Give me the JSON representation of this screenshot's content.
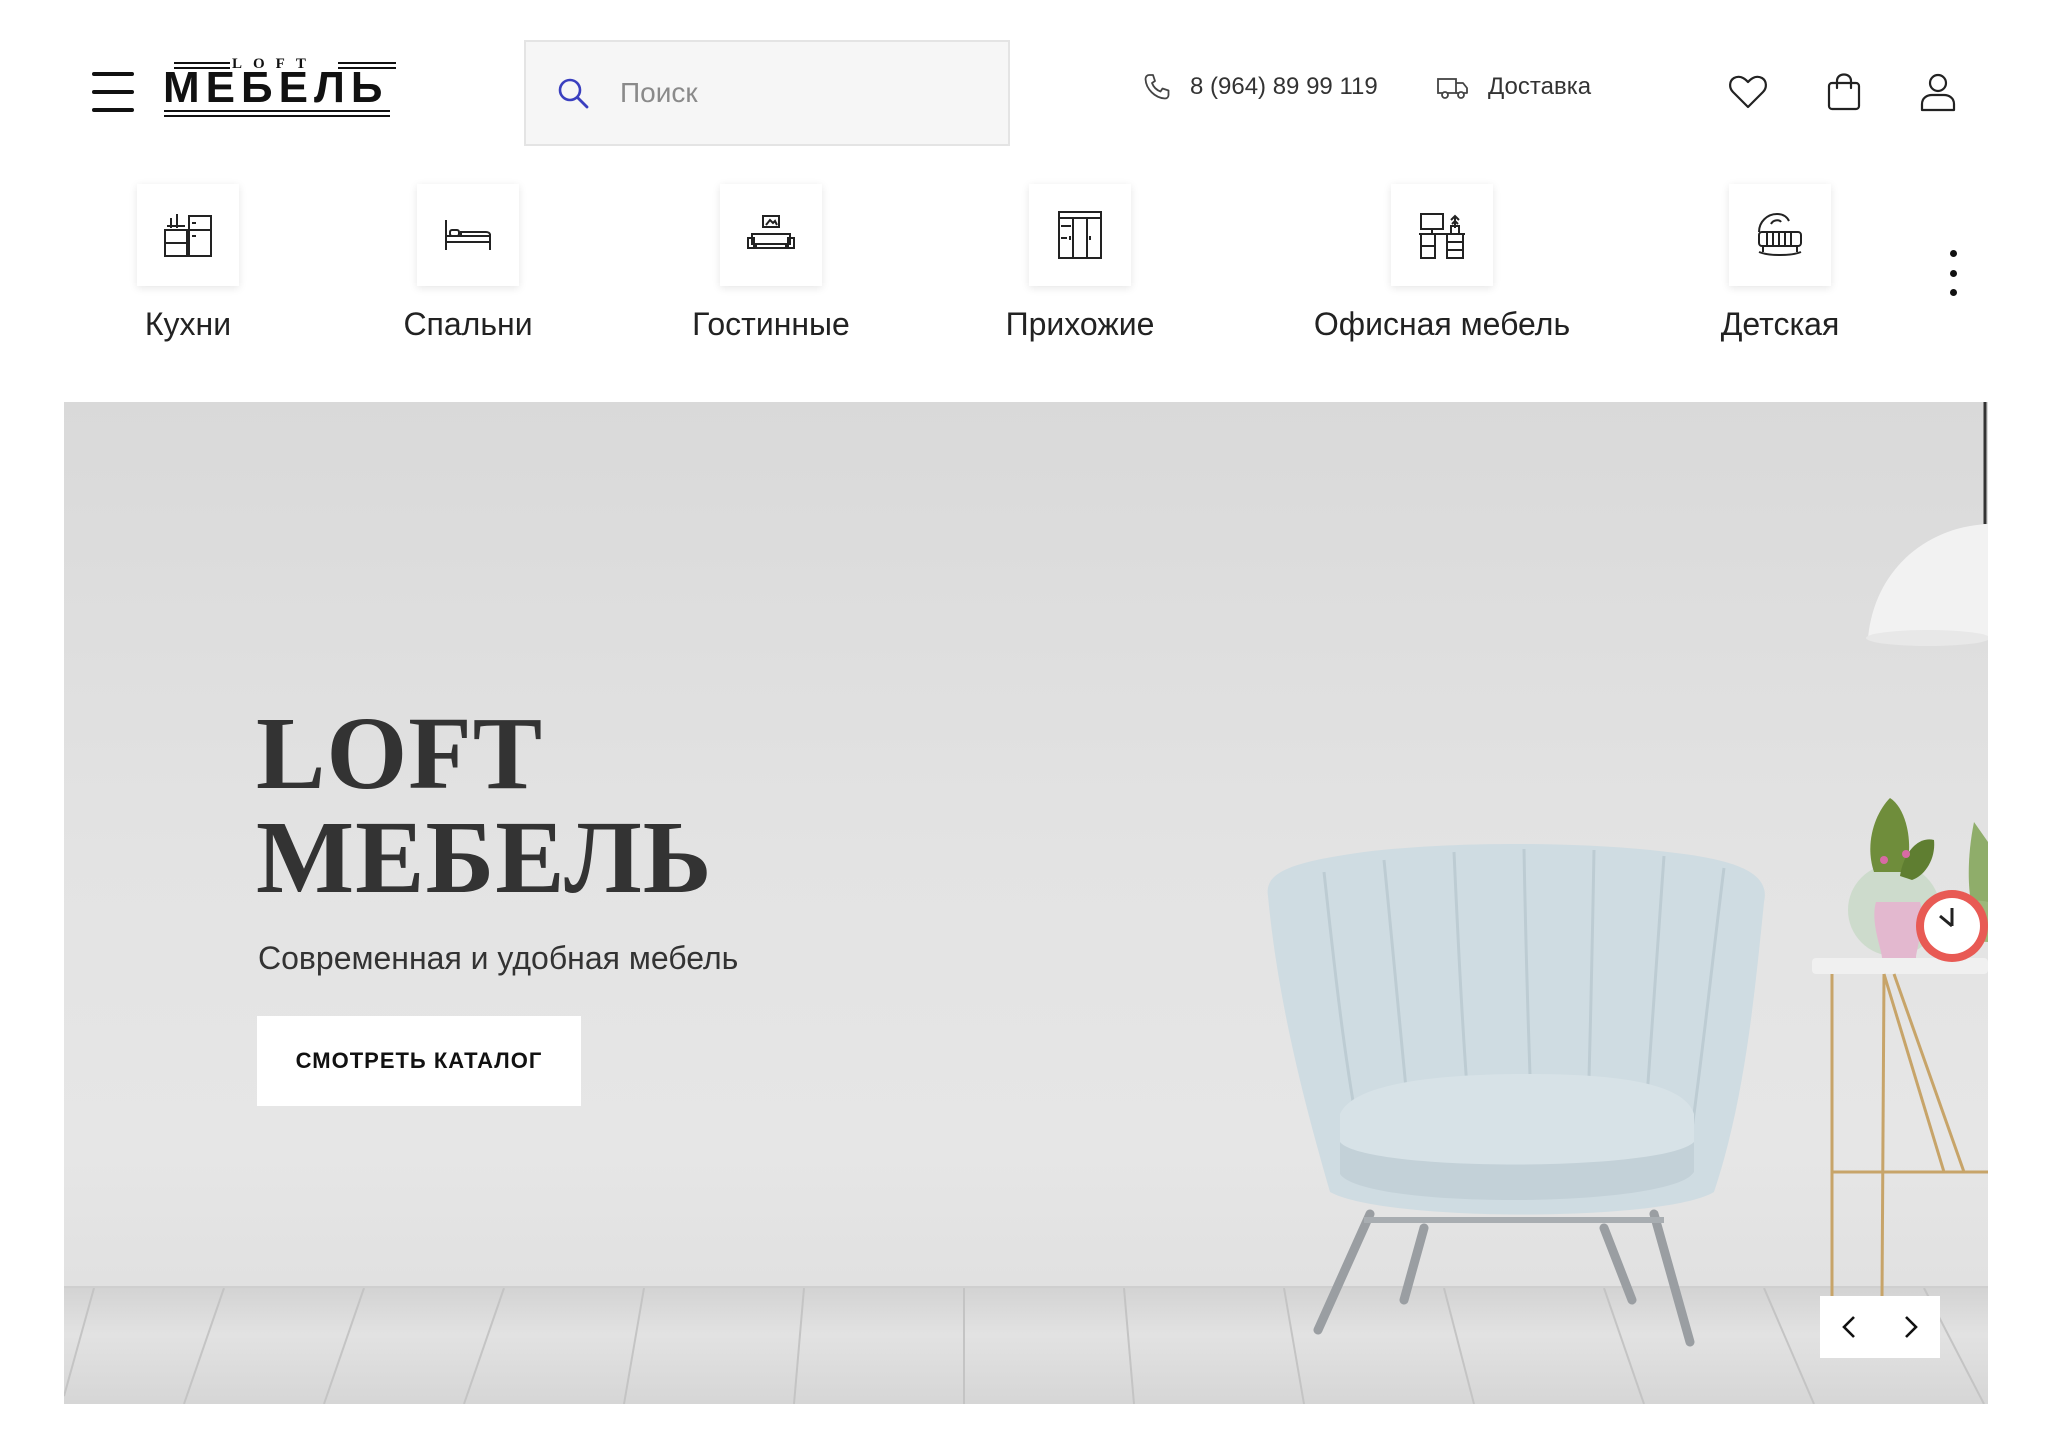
{
  "header": {
    "logo": {
      "small": "LOFT",
      "big": "МЕБЕЛЬ"
    },
    "search": {
      "placeholder": "Поиск"
    },
    "phone": "8 (964) 89 99 119",
    "delivery": "Доставка",
    "icons": {
      "menu": "hamburger-icon",
      "search": "search-icon",
      "phone": "phone-icon",
      "delivery": "truck-icon",
      "favorites": "heart-icon",
      "cart": "shopping-bag-icon",
      "account": "user-icon"
    }
  },
  "categories": [
    {
      "label": "Кухни",
      "icon": "kitchen-icon"
    },
    {
      "label": "Спальни",
      "icon": "bed-icon"
    },
    {
      "label": "Гостинные",
      "icon": "living-room-icon"
    },
    {
      "label": "Прихожие",
      "icon": "wardrobe-icon"
    },
    {
      "label": "Офисная мебель",
      "icon": "office-desk-icon"
    },
    {
      "label": "Детская",
      "icon": "crib-icon"
    }
  ],
  "hero": {
    "title_line1": "LOFT",
    "title_line2": "МЕБЕЛЬ",
    "subtitle": "Современная и удобная мебель",
    "button": "СМОТРЕТЬ КАТАЛОГ",
    "prev_icon": "chevron-left-icon",
    "next_icon": "chevron-right-icon"
  },
  "colors": {
    "text": "#222222",
    "accent_search_icon": "#3a3fbf",
    "hero_background": "#e3e3e3",
    "chair": "#cfdce2"
  }
}
